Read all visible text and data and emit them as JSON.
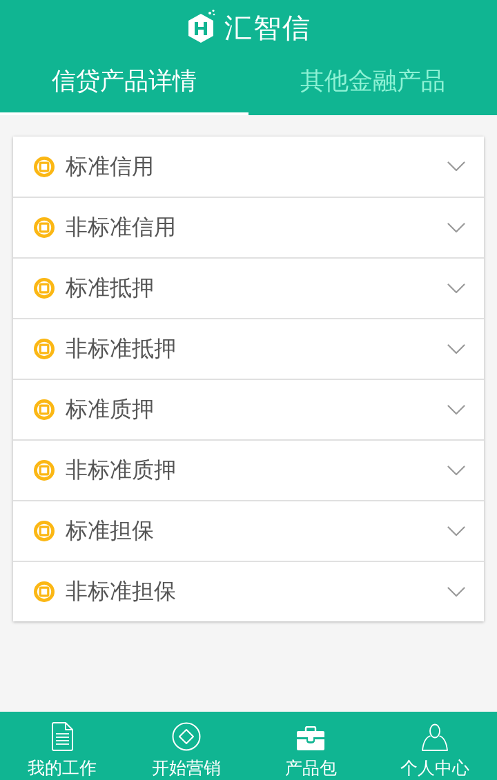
{
  "header": {
    "title": "汇智信"
  },
  "tabs": [
    {
      "label": "信贷产品详情",
      "selected": true
    },
    {
      "label": "其他金融产品",
      "selected": false
    }
  ],
  "categories": [
    {
      "label": "标准信用",
      "expanded": false
    },
    {
      "label": "非标准信用",
      "expanded": false
    },
    {
      "label": "标准抵押",
      "expanded": false
    },
    {
      "label": "非标准抵押",
      "expanded": false
    },
    {
      "label": "标准质押",
      "expanded": false
    },
    {
      "label": "非标准质押",
      "expanded": false
    },
    {
      "label": "标准担保",
      "expanded": false
    },
    {
      "label": "非标准担保",
      "expanded": false
    }
  ],
  "bottom_nav": [
    {
      "label": "我的工作"
    },
    {
      "label": "开始营销"
    },
    {
      "label": "产品包"
    },
    {
      "label": "个人中心"
    }
  ]
}
